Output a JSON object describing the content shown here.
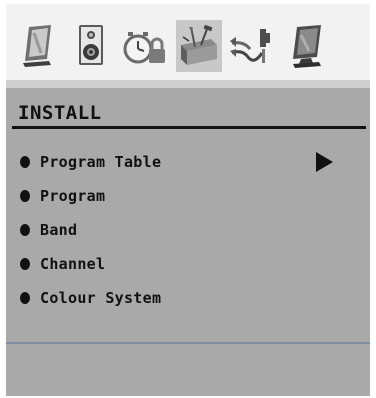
{
  "menu": {
    "title": "INSTALL",
    "items": [
      {
        "label": "Program Table",
        "has_submenu": true
      },
      {
        "label": "Program",
        "has_submenu": false
      },
      {
        "label": "Band",
        "has_submenu": false
      },
      {
        "label": "Channel",
        "has_submenu": false
      },
      {
        "label": "Colour System",
        "has_submenu": false
      }
    ]
  },
  "tabs": [
    {
      "icon": "picture-icon",
      "active": false
    },
    {
      "icon": "speaker-icon",
      "active": false
    },
    {
      "icon": "timer-lock-icon",
      "active": false
    },
    {
      "icon": "toolbox-icon",
      "active": true
    },
    {
      "icon": "connector-cables-icon",
      "active": false
    },
    {
      "icon": "monitor-icon",
      "active": false
    }
  ],
  "colors": {
    "panel": "#a9a9a9",
    "icon_bar": "#f2f2f2",
    "active_tab": "#c8c8c8",
    "text": "#111111"
  }
}
